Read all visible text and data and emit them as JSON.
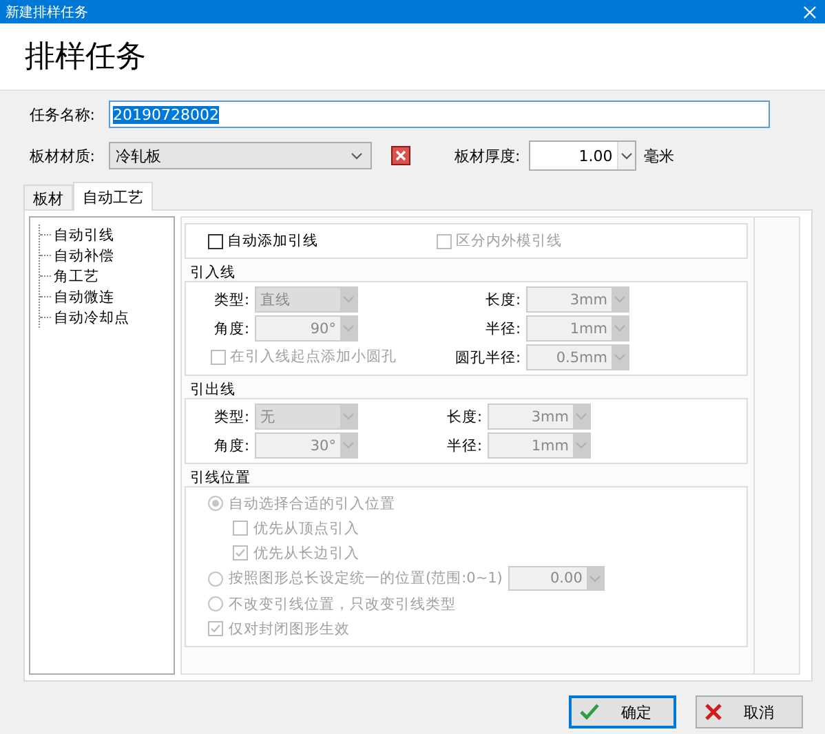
{
  "window": {
    "title": "新建排样任务"
  },
  "header": {
    "title": "排样任务"
  },
  "task_name": {
    "label": "任务名称:",
    "value": "20190728002",
    "text_selected": true
  },
  "material": {
    "label": "板材材质:",
    "value": "冷轧板"
  },
  "thickness": {
    "label": "板材厚度:",
    "value": "1.00",
    "unit": "毫米"
  },
  "tabs": [
    {
      "label": "板材",
      "selected": false
    },
    {
      "label": "自动工艺",
      "selected": true
    }
  ],
  "tree": {
    "items": [
      {
        "label": "自动引线"
      },
      {
        "label": "自动补偿"
      },
      {
        "label": "角工艺"
      },
      {
        "label": "自动微连"
      },
      {
        "label": "自动冷却点"
      }
    ]
  },
  "options": [
    {
      "label": "自动添加引线",
      "checked": false,
      "disabled": false
    },
    {
      "label": "区分内外模引线",
      "checked": false,
      "disabled": true
    }
  ],
  "lead_in": {
    "title": "引入线",
    "disabled": true,
    "left": [
      {
        "label": "类型:",
        "value": "直线",
        "kind": "select"
      },
      {
        "label": "角度:",
        "value": "90°",
        "kind": "number"
      }
    ],
    "right": [
      {
        "label": "长度:",
        "value": "3mm",
        "kind": "number"
      },
      {
        "label": "半径:",
        "value": "1mm",
        "kind": "number"
      },
      {
        "label": "圆孔半径:",
        "value": "0.5mm",
        "kind": "number"
      }
    ],
    "checkbox": {
      "label": "在引入线起点添加小圆孔",
      "checked": false
    }
  },
  "lead_out": {
    "title": "引出线",
    "disabled": true,
    "left": [
      {
        "label": "类型:",
        "value": "无",
        "kind": "select"
      },
      {
        "label": "角度:",
        "value": "30°",
        "kind": "number"
      }
    ],
    "right": [
      {
        "label": "长度:",
        "value": "3mm",
        "kind": "number"
      },
      {
        "label": "半径:",
        "value": "1mm",
        "kind": "number"
      }
    ]
  },
  "lead_position": {
    "title": "引线位置",
    "disabled": true,
    "options": [
      {
        "kind": "radio",
        "label": "自动选择合适的引入位置",
        "selected": true,
        "children": [
          {
            "kind": "checkbox",
            "label": "优先从顶点引入",
            "checked": false
          },
          {
            "kind": "checkbox",
            "label": "优先从长边引入",
            "checked": true
          }
        ]
      },
      {
        "kind": "radio",
        "label": "按照图形总长设定统一的位置(范围:0~1)",
        "selected": false,
        "value": "0.00"
      },
      {
        "kind": "radio",
        "label": "不改变引线位置，只改变引线类型",
        "selected": false
      },
      {
        "kind": "checkbox",
        "label": "仅对封闭图形生效",
        "checked": true
      }
    ]
  },
  "buttons": [
    {
      "label": "确定",
      "kind": "ok",
      "default": true
    },
    {
      "label": "取消",
      "kind": "cancel",
      "default": false
    }
  ]
}
